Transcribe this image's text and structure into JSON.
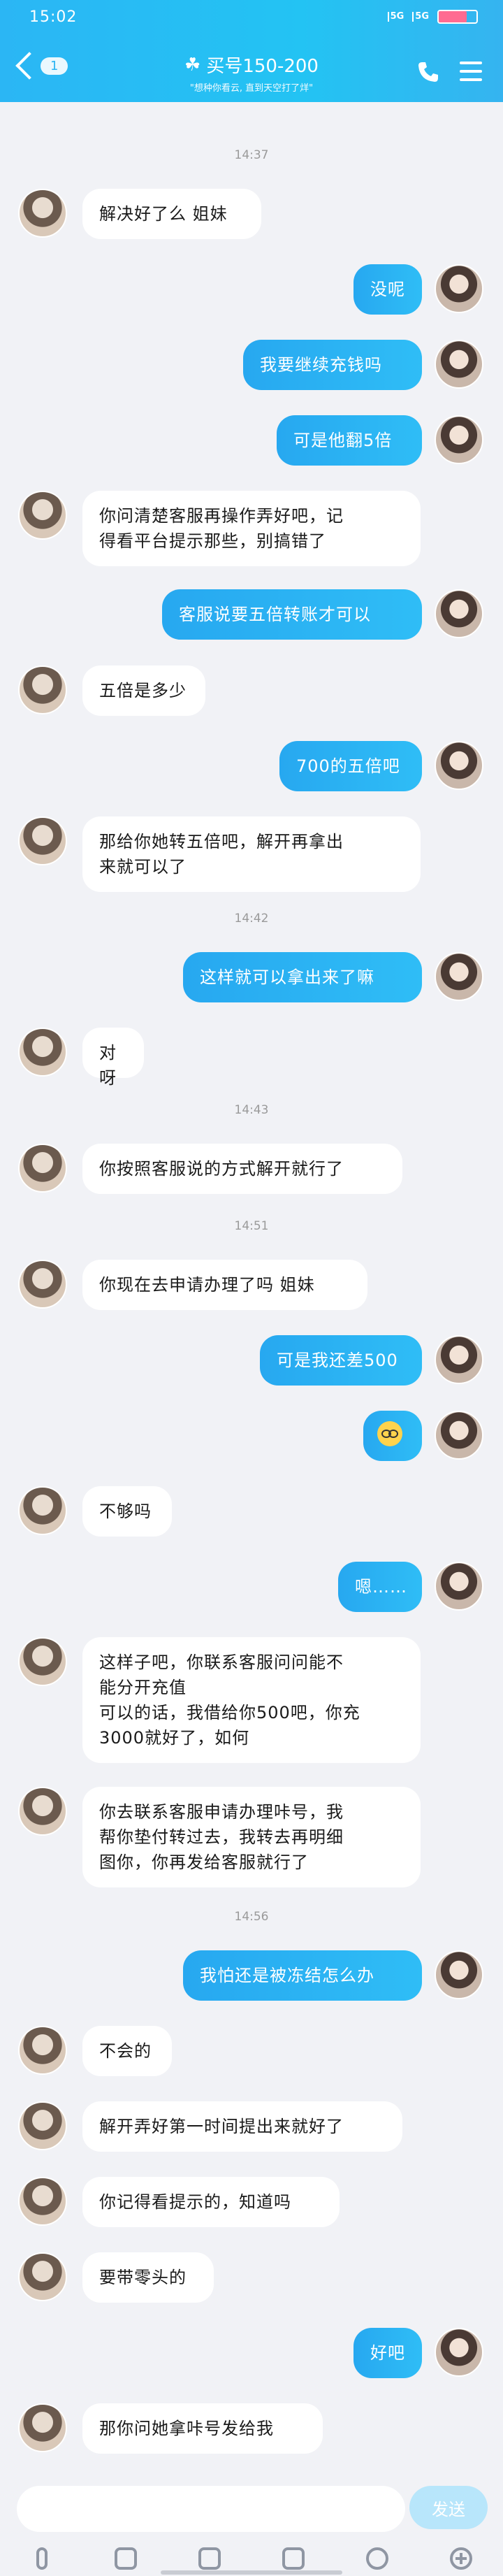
{
  "status": {
    "time": "15:02",
    "signal_labels": [
      "5G",
      "5G"
    ],
    "battery_color": "#ff6b91"
  },
  "header": {
    "unread_count": "1",
    "title": "买号150-200",
    "subtitle": "\"想种你看云, 直到天空打了烊\"",
    "accent_color": "#29b4f3"
  },
  "messages": [
    {
      "type": "in",
      "text": "解决好了么 姐妹"
    },
    {
      "type": "out",
      "text": "没呢"
    },
    {
      "type": "out",
      "text": "我要继续充钱吗"
    },
    {
      "type": "out",
      "text": "可是他翻5倍"
    },
    {
      "type": "in",
      "text": "你问清楚客服再操作弄好吧，记\n得看平台提示那些，别搞错了"
    },
    {
      "type": "out",
      "text": "客服说要五倍转账才可以"
    },
    {
      "type": "in",
      "text": "五倍是多少"
    },
    {
      "type": "out",
      "text": "700的五倍吧"
    },
    {
      "type": "in",
      "text": "那给你她转五倍吧，解开再拿出\n来就可以了"
    },
    {
      "type": "out",
      "text": "这样就可以拿出来了嘛"
    },
    {
      "type": "in",
      "text": "对呀"
    },
    {
      "type": "in",
      "text": "你按照客服说的方式解开就行了"
    },
    {
      "type": "in",
      "text": "你现在去申请办理了吗 姐妹"
    },
    {
      "type": "out",
      "text": "可是我还差500"
    },
    {
      "type": "out",
      "text": "",
      "icon": "worried-face-emoji"
    },
    {
      "type": "in",
      "text": "不够吗"
    },
    {
      "type": "out",
      "text": "嗯……"
    },
    {
      "type": "in",
      "text": "这样子吧，你联系客服问问能不\n能分开充值\n可以的话，我借给你500吧，你充\n3000就好了，如何"
    },
    {
      "type": "in",
      "text": "你去联系客服申请办理咔号，我\n帮你垫付转过去，我转去再明细\n图你，你再发给客服就行了"
    },
    {
      "type": "out",
      "text": "我怕还是被冻结怎么办"
    },
    {
      "type": "in",
      "text": "不会的"
    },
    {
      "type": "in",
      "text": "解开弄好第一时间提出来就好了"
    },
    {
      "type": "in",
      "text": "你记得看提示的，知道吗"
    },
    {
      "type": "in",
      "text": "要带零头的"
    },
    {
      "type": "out",
      "text": "好吧"
    },
    {
      "type": "in",
      "text": "那你问她拿咔号发给我"
    }
  ],
  "timestamps": [
    "14:37",
    "14:42",
    "14:43",
    "14:51",
    "14:56"
  ],
  "input": {
    "placeholder": "",
    "send_label": "发送"
  },
  "toolbar": {
    "icons": [
      "microphone-icon",
      "image-icon",
      "camera-icon",
      "red-packet-icon",
      "emoji-icon",
      "plus-icon"
    ]
  }
}
